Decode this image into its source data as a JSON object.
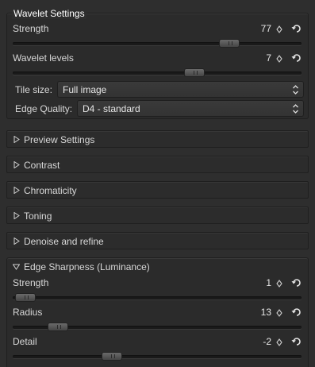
{
  "wavelet": {
    "title": "Wavelet Settings",
    "strength": {
      "label": "Strength",
      "value": "77",
      "level": 0.77
    },
    "levels": {
      "label": "Wavelet levels",
      "value": "7",
      "level": 0.64
    },
    "tile_size": {
      "label": "Tile size:",
      "selected": "Full image"
    },
    "edge_quality": {
      "label": "Edge Quality:",
      "selected": "D4 - standard"
    }
  },
  "sections": {
    "preview": "Preview Settings",
    "contrast": "Contrast",
    "chromaticity": "Chromaticity",
    "toning": "Toning",
    "denoise": "Denoise and refine"
  },
  "edge_sharpness": {
    "title": "Edge Sharpness (Luminance)",
    "strength": {
      "label": "Strength",
      "value": "1",
      "level": 0.01
    },
    "radius": {
      "label": "Radius",
      "value": "13",
      "level": 0.13
    },
    "detail": {
      "label": "Detail",
      "value": "-2",
      "level": 0.33
    }
  },
  "icons": {
    "spin": "spinner-arrows-icon",
    "reset": "reset-undo-icon",
    "collapsed": "triangle-right-icon",
    "expanded": "triangle-down-icon",
    "combo": "updown-arrows-icon"
  },
  "colors": {
    "background": "#2e2e2e",
    "text": "#d6d6d6",
    "title": "#ffffff"
  }
}
